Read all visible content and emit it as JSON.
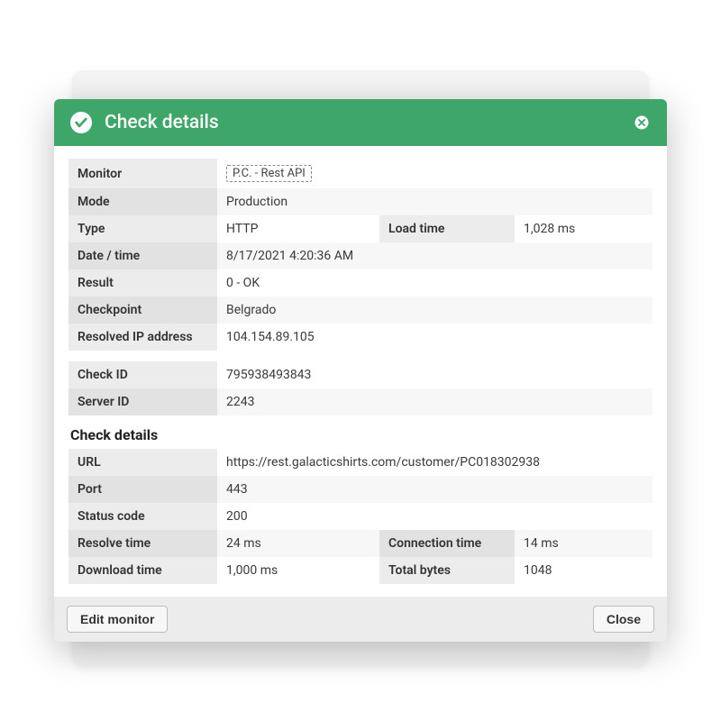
{
  "header": {
    "title": "Check details"
  },
  "general": {
    "monitor_label": "Monitor",
    "monitor_value": "P.C. - Rest API",
    "mode_label": "Mode",
    "mode_value": "Production",
    "type_label": "Type",
    "type_value": "HTTP",
    "load_time_label": "Load time",
    "load_time_value": "1,028 ms",
    "datetime_label": "Date / time",
    "datetime_value": "8/17/2021 4:20:36 AM",
    "result_label": "Result",
    "result_value": "0 - OK",
    "checkpoint_label": "Checkpoint",
    "checkpoint_value": "Belgrado",
    "resolved_ip_label": "Resolved IP address",
    "resolved_ip_value": "104.154.89.105"
  },
  "ids": {
    "check_id_label": "Check ID",
    "check_id_value": "795938493843",
    "server_id_label": "Server ID",
    "server_id_value": "2243"
  },
  "details": {
    "heading": "Check details",
    "url_label": "URL",
    "url_value": "https://rest.galacticshirts.com/customer/PC018302938",
    "port_label": "Port",
    "port_value": "443",
    "status_code_label": "Status code",
    "status_code_value": "200",
    "resolve_time_label": "Resolve time",
    "resolve_time_value": "24 ms",
    "connection_time_label": "Connection time",
    "connection_time_value": "14 ms",
    "download_time_label": "Download time",
    "download_time_value": "1,000 ms",
    "total_bytes_label": "Total bytes",
    "total_bytes_value": "1048"
  },
  "footer": {
    "edit_monitor": "Edit monitor",
    "close": "Close"
  }
}
